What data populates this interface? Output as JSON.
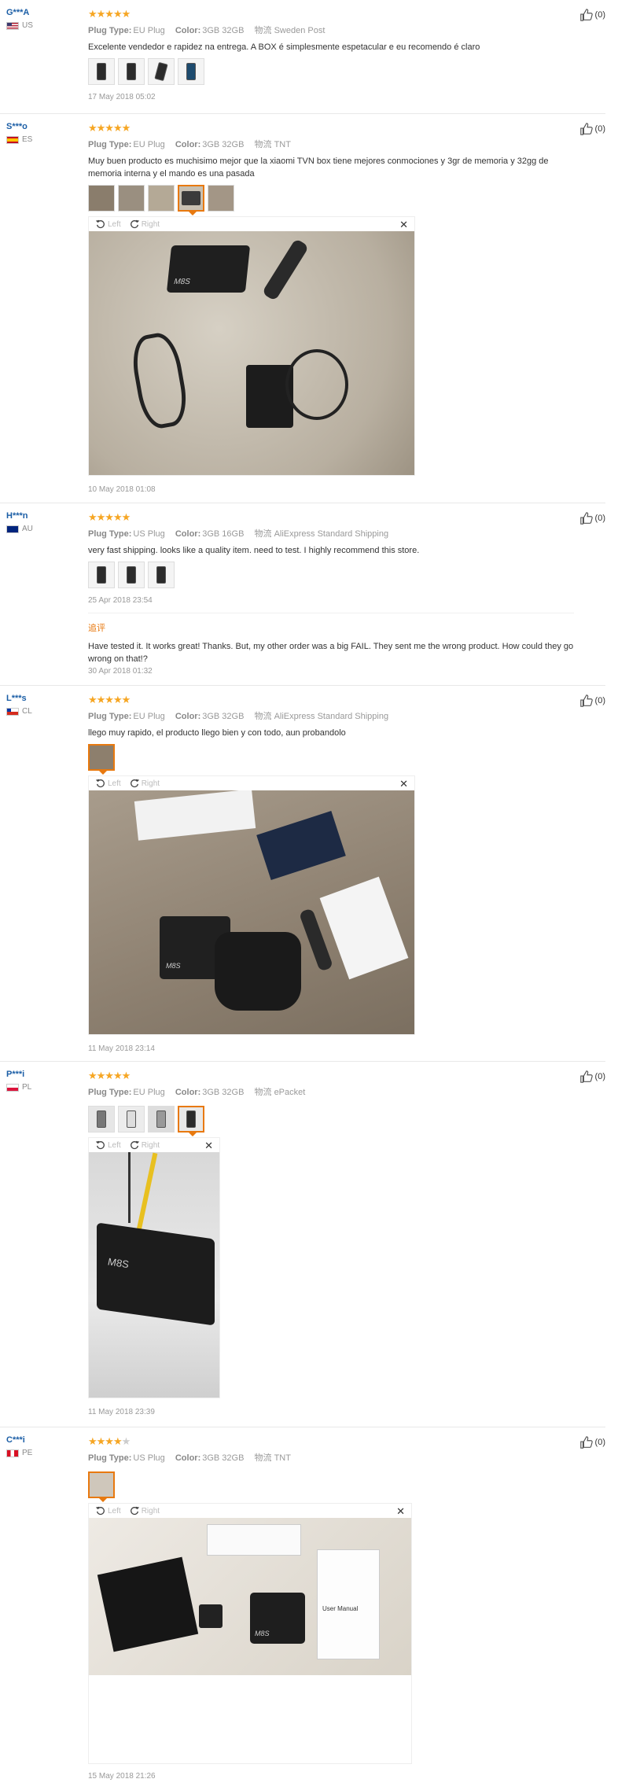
{
  "labels": {
    "plug": "Plug Type:",
    "color": "Color:",
    "shipping": "物流",
    "left": "Left",
    "right": "Right",
    "reply": "追评"
  },
  "reviews": [
    {
      "user": "G***A",
      "country": "US",
      "rating": 5,
      "plug": "EU Plug",
      "color": "3GB 32GB",
      "shipping": "Sweden Post",
      "text": "Excelente vendedor e rapidez na entrega. A BOX é simplesmente espetacular e eu recomendo é claro",
      "date": "17 May 2018 05:02",
      "helpful": "(0)"
    },
    {
      "user": "S***o",
      "country": "ES",
      "rating": 5,
      "plug": "EU Plug",
      "color": "3GB 32GB",
      "shipping": "TNT",
      "text": "Muy buen producto es muchisimo mejor que la xiaomi TVN box tiene mejores conmociones y 3gr de memoria y 32gg de memoria interna y el mando es una pasada",
      "date": "10 May 2018 01:08",
      "helpful": "(0)"
    },
    {
      "user": "H***n",
      "country": "AU",
      "rating": 5,
      "plug": "US Plug",
      "color": "3GB 16GB",
      "shipping": "AliExpress Standard Shipping",
      "text": "very fast shipping. looks like a quality item. need to test. I highly recommend this store.",
      "date": "25 Apr 2018 23:54",
      "helpful": "(0)",
      "followup": "Have tested it. It works great! Thanks. But, my other order was a big FAIL. They sent me the wrong product. How could they go wrong on that!?",
      "followup_date": "30 Apr 2018 01:32"
    },
    {
      "user": "L***s",
      "country": "CL",
      "rating": 5,
      "plug": "EU Plug",
      "color": "3GB 32GB",
      "shipping": "AliExpress Standard Shipping",
      "text": "llego muy rapido, el producto llego bien y con todo, aun probandolo",
      "date": "11 May 2018 23:14",
      "helpful": "(0)"
    },
    {
      "user": "P***i",
      "country": "PL",
      "rating": 5,
      "plug": "EU Plug",
      "color": "3GB 32GB",
      "shipping": "ePacket",
      "text": "",
      "date": "11 May 2018 23:39",
      "helpful": "(0)"
    },
    {
      "user": "C***i",
      "country": "PE",
      "rating": 4,
      "plug": "US Plug",
      "color": "3GB 32GB",
      "shipping": "TNT",
      "text": "",
      "date": "15 May 2018 21:26",
      "helpful": "(0)"
    }
  ],
  "photo_text": {
    "box_logo": "M8S",
    "manual": "User Manual"
  }
}
